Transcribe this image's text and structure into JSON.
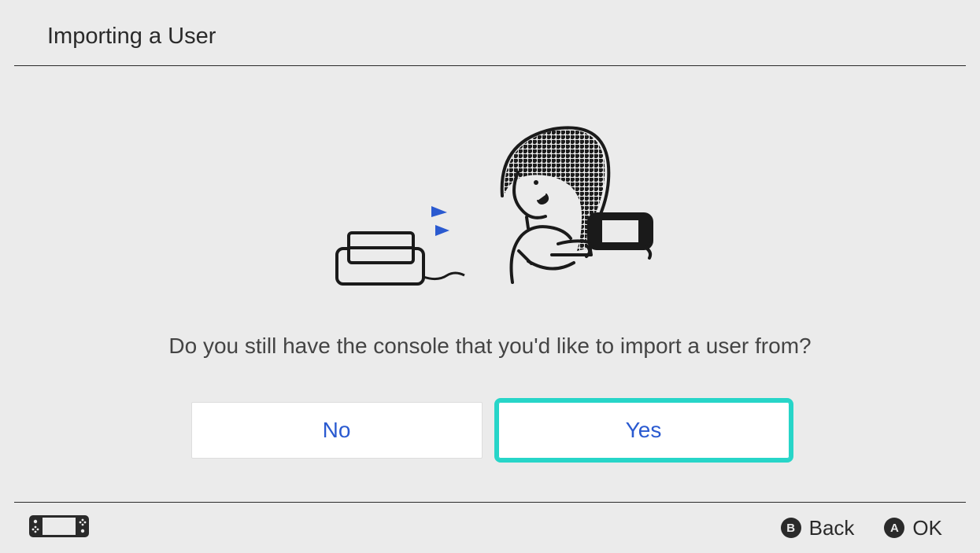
{
  "header": {
    "title": "Importing a User"
  },
  "main": {
    "question": "Do you still have the console that you'd like to import a user from?",
    "buttons": {
      "no": "No",
      "yes": "Yes"
    },
    "selected": "yes"
  },
  "footer": {
    "back": {
      "button_letter": "B",
      "label": "Back"
    },
    "ok": {
      "button_letter": "A",
      "label": "OK"
    }
  }
}
